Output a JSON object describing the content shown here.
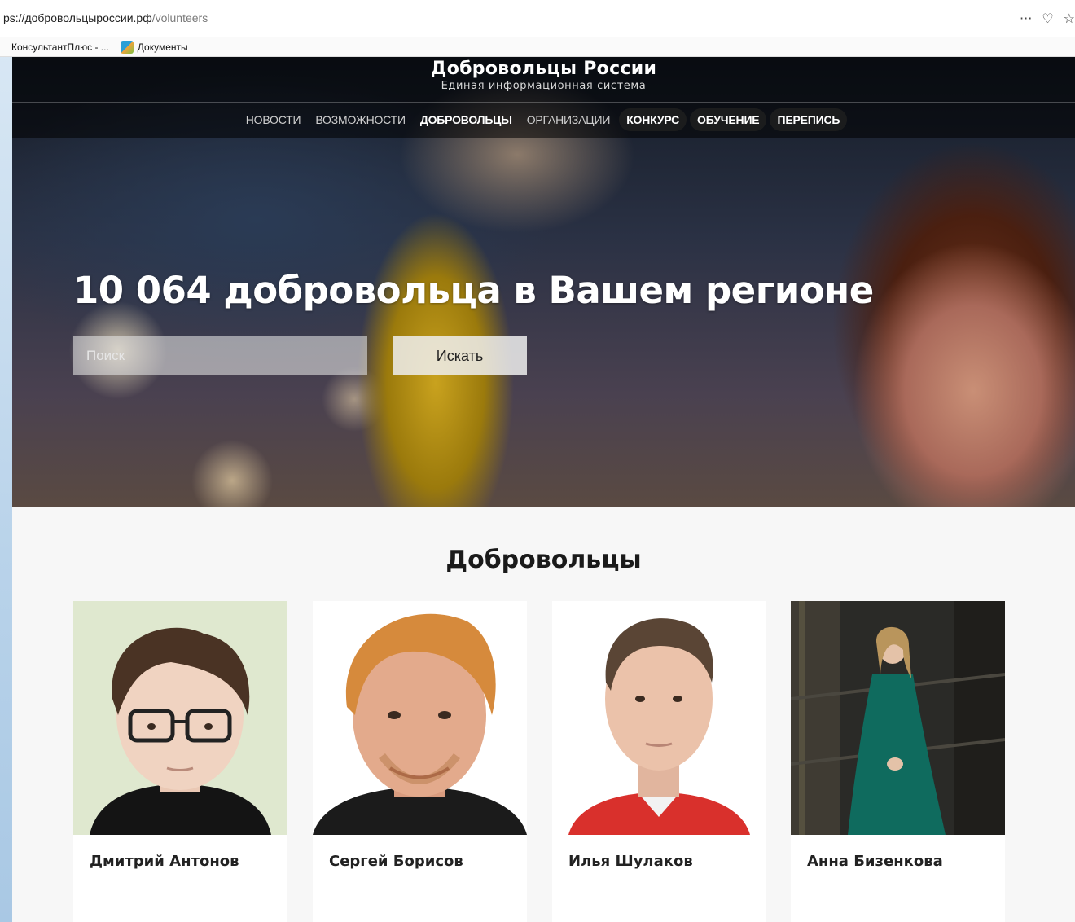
{
  "browser": {
    "url_host": "ps://добровольцыроссии.рф",
    "url_path": "/volunteers",
    "actions": {
      "more": "···",
      "pocket": "♡",
      "star": "☆"
    },
    "bookmarks": [
      {
        "label": "КонсультантПлюс - ..."
      },
      {
        "label": "Документы"
      }
    ]
  },
  "site": {
    "title": "Добровольцы России",
    "subtitle": "Единая информационная система",
    "nav": [
      {
        "label": "НОВОСТИ"
      },
      {
        "label": "ВОЗМОЖНОСТИ"
      },
      {
        "label": "ДОБРОВОЛЬЦЫ"
      },
      {
        "label": "ОРГАНИЗАЦИИ"
      },
      {
        "label": "КОНКУРС"
      },
      {
        "label": "ОБУЧЕНИЕ"
      },
      {
        "label": "ПЕРЕПИСЬ"
      }
    ],
    "hero": {
      "headline": "10 064 добровольца в Вашем регионе",
      "search_placeholder": "Поиск",
      "search_button": "Искать"
    },
    "section_title": "Добровольцы",
    "volunteers": [
      {
        "name": "Дмитрий Антонов"
      },
      {
        "name": "Сергей Борисов"
      },
      {
        "name": "Илья Шулаков"
      },
      {
        "name": "Анна Бизенкова"
      }
    ]
  },
  "colors": {
    "page_bg": "#f7f7f7",
    "hero_text": "#ffffff",
    "pill_bg": "#1e1e1e"
  }
}
